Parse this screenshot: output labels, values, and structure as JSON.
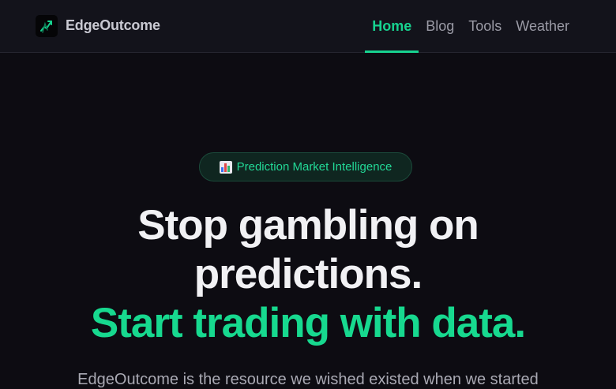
{
  "brand": {
    "name": "EdgeOutcome",
    "logo_icon": "trend-chart-icon"
  },
  "nav": {
    "items": [
      {
        "label": "Home",
        "active": true
      },
      {
        "label": "Blog",
        "active": false
      },
      {
        "label": "Tools",
        "active": false
      },
      {
        "label": "Weather",
        "active": false
      }
    ]
  },
  "hero": {
    "badge_icon": "bar-chart-icon",
    "badge_text": "Prediction Market Intelligence",
    "headline_line1": "Stop gambling on",
    "headline_line2": "predictions.",
    "headline_line3": "Start trading with data.",
    "intro": "EdgeOutcome is the resource we wished existed when we started"
  },
  "colors": {
    "accent": "#17d390",
    "background": "#0d0c12",
    "header_background": "#13131b",
    "heading_text": "#f1f1f4",
    "muted_text": "#9b9ba6"
  }
}
